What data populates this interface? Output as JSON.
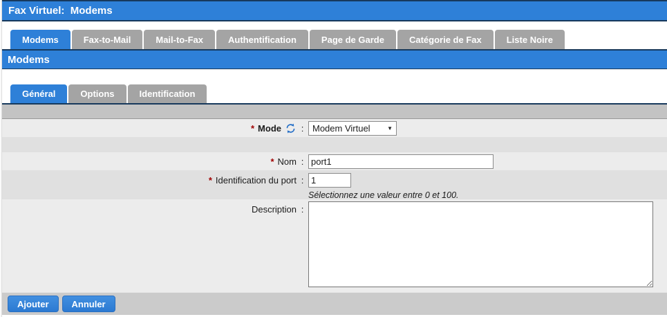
{
  "header": {
    "title": "Fax Virtuel:  Modems"
  },
  "section_title": "Modems",
  "main_tabs": [
    {
      "label": "Modems",
      "active": true
    },
    {
      "label": "Fax-to-Mail",
      "active": false
    },
    {
      "label": "Mail-to-Fax",
      "active": false
    },
    {
      "label": "Authentification",
      "active": false
    },
    {
      "label": "Page de Garde",
      "active": false
    },
    {
      "label": "Catégorie de Fax",
      "active": false
    },
    {
      "label": "Liste Noire",
      "active": false
    }
  ],
  "sub_tabs": [
    {
      "label": "Général",
      "active": true
    },
    {
      "label": "Options",
      "active": false
    },
    {
      "label": "Identification",
      "active": false
    }
  ],
  "punctuation": {
    "colon": ":",
    "required_marker": "*",
    "dropdown_arrow": "▼"
  },
  "form": {
    "mode": {
      "label": "Mode",
      "required": true,
      "value": "Modem Virtuel",
      "icon": "refresh-icon"
    },
    "nom": {
      "label": "Nom",
      "required": true,
      "value": "port1"
    },
    "port": {
      "label": "Identification du port",
      "required": true,
      "value": "1",
      "hint": "Sélectionnez une valeur entre 0 et 100."
    },
    "description": {
      "label": "Description",
      "value": ""
    }
  },
  "buttons": {
    "add": "Ajouter",
    "cancel": "Annuler"
  },
  "colors": {
    "accent_blue": "#2e80d8",
    "navy_border": "#17395c",
    "inactive_tab_gray": "#a4a4a4",
    "row_light": "#ececec",
    "row_mid": "#e0e0e0",
    "row_header_gray": "#c3c3c3",
    "button_row_gray": "#cbcbcb",
    "required_red": "#a00000",
    "refresh_icon_blue": "#2a72c8"
  }
}
